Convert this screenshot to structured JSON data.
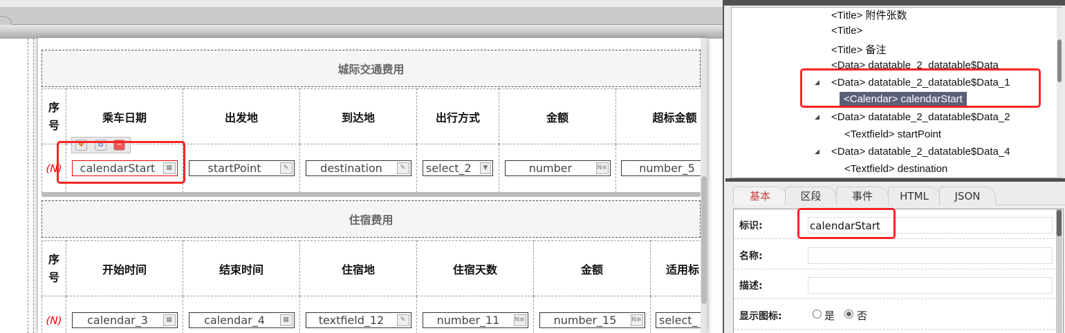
{
  "form": {
    "section1": {
      "title": "城际交通费用",
      "headers": [
        "序号",
        "乘车日期",
        "出发地",
        "到达地",
        "出行方式",
        "金额",
        "超标金额"
      ],
      "row": {
        "marker": "(N)",
        "fields": [
          "calendarStart",
          "startPoint",
          "destination",
          "select_2",
          "number",
          "number_5"
        ]
      }
    },
    "section2": {
      "title": "住宿费用",
      "headers": [
        "序号",
        "开始时间",
        "结束时间",
        "住宿地",
        "住宿天数",
        "金额",
        "适用标"
      ],
      "row": {
        "marker": "(N)",
        "fields": [
          "calendar_3",
          "calendar_4",
          "textfield_12",
          "number_11",
          "number_15",
          "select_"
        ]
      }
    }
  },
  "tree": {
    "nodes": [
      "<Title> 附件张数",
      "<Title>",
      "<Title> 备注",
      "<Data> datatable_2_datatable$Data",
      "<Data> datatable_2_datatable$Data_1",
      "<Calendar> calendarStart",
      "<Data> datatable_2_datatable$Data_2",
      "<Textfield> startPoint",
      "<Data> datatable_2_datatable$Data_4",
      "<Textfield> destination"
    ]
  },
  "props": {
    "tabs": [
      "基本",
      "区段",
      "事件",
      "HTML",
      "JSON"
    ],
    "id_label": "标识:",
    "id_value": "calendarStart",
    "name_label": "名称:",
    "desc_label": "描述:",
    "show_icon_label": "显示图标:",
    "yes": "是",
    "no": "否",
    "show_icon": "否"
  }
}
